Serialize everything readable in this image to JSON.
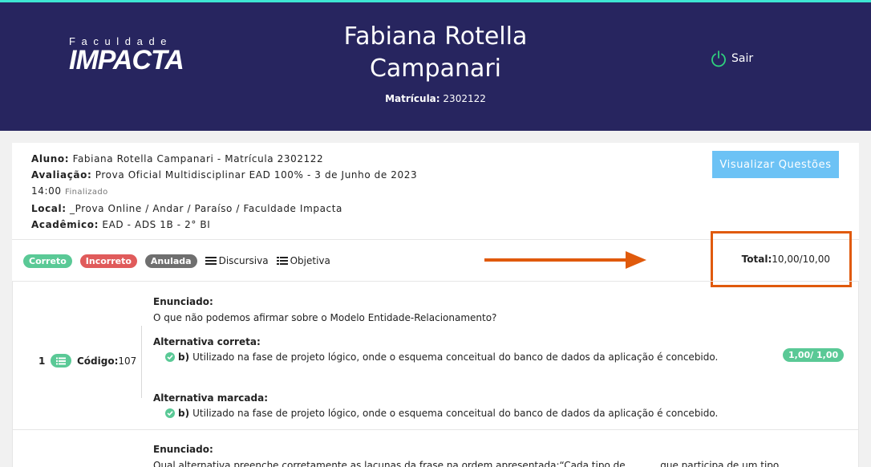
{
  "header": {
    "logo_small": "Faculdade",
    "logo_big": "IMPACTA",
    "student_name": "Fabiana Rotella Campanari",
    "matricula_label": "Matrícula:",
    "matricula_value": "2302122",
    "logout_label": "Sair"
  },
  "info": {
    "aluno_label": "Aluno:",
    "aluno_value": "Fabiana Rotella Campanari - Matrícula 2302122",
    "avaliacao_label": "Avaliação:",
    "avaliacao_value": "Prova Oficial Multidisciplinar EAD 100% - 3 de Junho de 2023",
    "hora": "14:00",
    "status": "Finalizado",
    "local_label": "Local:",
    "local_value": "_Prova Online / Andar / Paraíso / Faculdade Impacta",
    "academico_label": "Acadêmico:",
    "academico_value": "EAD - ADS 1B - 2° BI",
    "visualizar_button": "Visualizar Questões"
  },
  "legend": {
    "correto": "Correto",
    "incorreto": "Incorreto",
    "anulada": "Anulada",
    "discursiva": "Discursiva",
    "objetiva": "Objetiva"
  },
  "total": {
    "label": "Total:",
    "value": "10,00/10,00"
  },
  "questions": [
    {
      "number": "1",
      "codigo_label": "Código:",
      "codigo_value": "107",
      "enunciado_label": "Enunciado:",
      "enunciado_text": "O que não podemos afirmar sobre o Modelo Entidade-Relacionamento?",
      "correta_label": "Alternativa correta:",
      "correta_letter": "b)",
      "correta_text": "Utilizado na fase de projeto lógico, onde o esquema conceitual do banco de dados da aplicação é concebido.",
      "marcada_label": "Alternativa marcada:",
      "marcada_letter": "b)",
      "marcada_text": "Utilizado na fase de projeto lógico, onde o esquema conceitual do banco de dados da aplicação é concebido.",
      "score": "1,00/ 1,00"
    },
    {
      "enunciado_label": "Enunciado:",
      "enunciado_text": "Qual alternativa preenche corretamente as lacunas da frase na ordem apresentada:“Cada tipo de ______ que participa de um tipo"
    }
  ],
  "colors": {
    "header_bg": "#27255f",
    "accent_line": "#3ee6d3",
    "success": "#5ac996",
    "danger": "#e05b5b",
    "muted": "#6f6f6f",
    "button": "#6cc2f5",
    "annotation": "#e05a0c"
  },
  "icons": {
    "logout": "power-icon",
    "discursiva": "list-lines-icon",
    "objetiva": "list-bullets-icon",
    "question_type": "list-icon",
    "check": "check-circle-icon",
    "annotation": "arrow-right-icon"
  }
}
